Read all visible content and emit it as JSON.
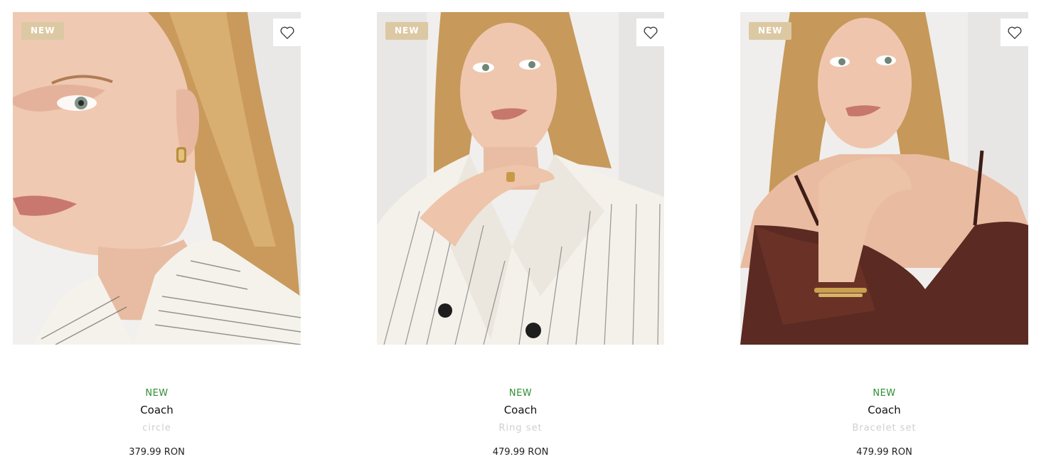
{
  "products": [
    {
      "badge": "NEW",
      "flag": "NEW",
      "brand": "Coach",
      "name": "circle",
      "price": "379.99 RON",
      "wishlist_icon": "heart-outline-icon"
    },
    {
      "badge": "NEW",
      "flag": "NEW",
      "brand": "Coach",
      "name": "Ring set",
      "price": "479.99 RON",
      "wishlist_icon": "heart-outline-icon"
    },
    {
      "badge": "NEW",
      "flag": "NEW",
      "brand": "Coach",
      "name": "Bracelet set",
      "price": "479.99 RON",
      "wishlist_icon": "heart-outline-icon"
    }
  ],
  "colors": {
    "badge_bg": "#dcc9a4",
    "new_flag": "#2f8f35",
    "product_name": "#cfcfcf"
  }
}
